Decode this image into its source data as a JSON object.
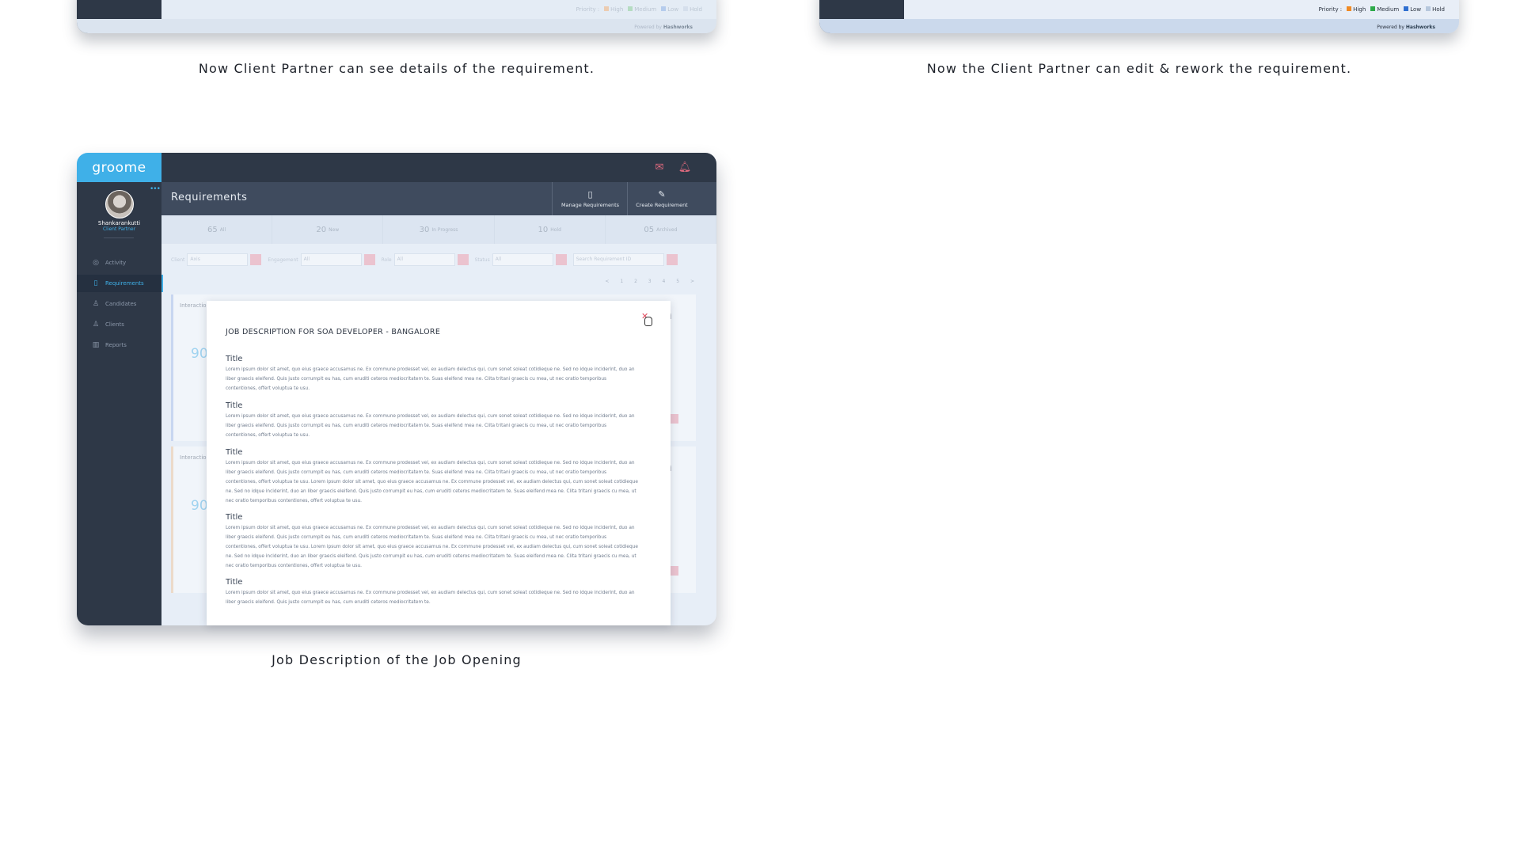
{
  "top_left_frame": {
    "legend": {
      "label": "Priority :",
      "items": [
        {
          "name": "High",
          "color": "#f3b27a"
        },
        {
          "name": "Medium",
          "color": "#8fcf9a"
        },
        {
          "name": "Low",
          "color": "#8fb3e8"
        },
        {
          "name": "Hold",
          "color": "#c9d6e6"
        }
      ]
    },
    "powered_prefix": "Powered by",
    "powered_brand": "Hashworks",
    "caption": "Now Client Partner can see details of the requirement."
  },
  "top_right_frame": {
    "legend": {
      "label": "Priority :",
      "items": [
        {
          "name": "High",
          "color": "#f08a24"
        },
        {
          "name": "Medium",
          "color": "#2eaa4a"
        },
        {
          "name": "Low",
          "color": "#2f6fd0"
        },
        {
          "name": "Hold",
          "color": "#b6c7dc"
        }
      ]
    },
    "powered_prefix": "Powered by",
    "powered_brand": "Hashworks",
    "caption": "Now the Client Partner can edit & rework the requirement."
  },
  "app": {
    "brand": "groome",
    "user": {
      "name": "Shankarankutti",
      "role": "Client Partner"
    },
    "nav": [
      {
        "label": "Activity",
        "icon": "activity-icon",
        "glyph": "◎",
        "active": false
      },
      {
        "label": "Requirements",
        "icon": "document-icon",
        "glyph": "▯",
        "active": true
      },
      {
        "label": "Candidates",
        "icon": "candidates-icon",
        "glyph": "♙",
        "active": false
      },
      {
        "label": "Clients",
        "icon": "clients-icon",
        "glyph": "♙",
        "active": false
      },
      {
        "label": "Reports",
        "icon": "reports-icon",
        "glyph": "▥",
        "active": false
      }
    ],
    "page_title": "Requirements",
    "header_buttons": {
      "manage": "Manage Requirements",
      "create": "Create Requirement"
    },
    "stats": [
      {
        "value": "65",
        "label": "All"
      },
      {
        "value": "20",
        "label": "New"
      },
      {
        "value": "30",
        "label": "In Progress"
      },
      {
        "value": "10",
        "label": "Hold"
      },
      {
        "value": "05",
        "label": "Archived"
      }
    ],
    "filters": [
      {
        "label": "Client",
        "value": "Axis"
      },
      {
        "label": "Engagement",
        "value": "All"
      },
      {
        "label": "Role",
        "value": "All"
      },
      {
        "label": "Status",
        "value": "All"
      },
      {
        "label": "",
        "value": "Search Requirement ID"
      }
    ],
    "pager": "< 1 2 3 4 5 >",
    "cards": [
      {
        "title": "Interaction",
        "number": "90",
        "letter": "a"
      },
      {
        "title": "Interaction",
        "number": "90",
        "letter": "a"
      }
    ],
    "modal": {
      "title": "JOB DESCRIPTION FOR SOA DEVELOPER - BANGALORE",
      "sections": [
        {
          "heading": "Title",
          "body": "Lorem ipsum dolor sit amet, quo eius graece accusamus ne. Ex commune prodesset vel, ex audiam delectus qui, cum sonet soleat cotidieque ne. Sed no idque inciderint, duo an liber graecis eleifend. Quis justo corrumpit eu has, cum eruditi ceteros mediocritatem te. Suas eleifend mea ne. Clita tritani graecis cu mea, ut nec oratio temporibus contentiones, offert voluptua te usu."
        },
        {
          "heading": "Title",
          "body": "Lorem ipsum dolor sit amet, quo eius graece accusamus ne. Ex commune prodesset vel, ex audiam delectus qui, cum sonet soleat cotidieque ne. Sed no idque inciderint, duo an liber graecis eleifend. Quis justo corrumpit eu has, cum eruditi ceteros mediocritatem te. Suas eleifend mea ne. Clita tritani graecis cu mea, ut nec oratio temporibus contentiones, offert voluptua te usu."
        },
        {
          "heading": "Title",
          "body": "Lorem ipsum dolor sit amet, quo eius graece accusamus ne. Ex commune prodesset vel, ex audiam delectus qui, cum sonet soleat cotidieque ne. Sed no idque inciderint, duo an liber graecis eleifend. Quis justo corrumpit eu has, cum eruditi ceteros mediocritatem te. Suas eleifend mea ne. Clita tritani graecis cu mea, ut nec oratio temporibus contentiones, offert voluptua te usu. Lorem ipsum dolor sit amet, quo eius graece accusamus ne. Ex commune prodesset vel, ex audiam delectus qui, cum sonet soleat cotidieque ne. Sed no idque inciderint, duo an liber graecis eleifend. Quis justo corrumpit eu has, cum eruditi ceteros mediocritatem te. Suas eleifend mea ne. Clita tritani graecis cu mea, ut nec oratio temporibus contentiones, offert voluptua te usu."
        },
        {
          "heading": "Title",
          "body": "Lorem ipsum dolor sit amet, quo eius graece accusamus ne. Ex commune prodesset vel, ex audiam delectus qui, cum sonet soleat cotidieque ne. Sed no idque inciderint, duo an liber graecis eleifend. Quis justo corrumpit eu has, cum eruditi ceteros mediocritatem te. Suas eleifend mea ne. Clita tritani graecis cu mea, ut nec oratio temporibus contentiones, offert voluptua te usu. Lorem ipsum dolor sit amet, quo eius graece accusamus ne. Ex commune prodesset vel, ex audiam delectus qui, cum sonet soleat cotidieque ne. Sed no idque inciderint, duo an liber graecis eleifend. Quis justo corrumpit eu has, cum eruditi ceteros mediocritatem te. Suas eleifend mea ne. Clita tritani graecis cu mea, ut nec oratio temporibus contentiones, offert voluptua te usu."
        },
        {
          "heading": "Title",
          "body": "Lorem ipsum dolor sit amet, quo eius graece accusamus ne. Ex commune prodesset vel, ex audiam delectus qui, cum sonet soleat cotidieque ne. Sed no idque inciderint, duo an liber graecis eleifend. Quis justo corrumpit eu has, cum eruditi ceteros mediocritatem te."
        }
      ]
    }
  },
  "bottom_caption": "Job Description of the Job Opening"
}
